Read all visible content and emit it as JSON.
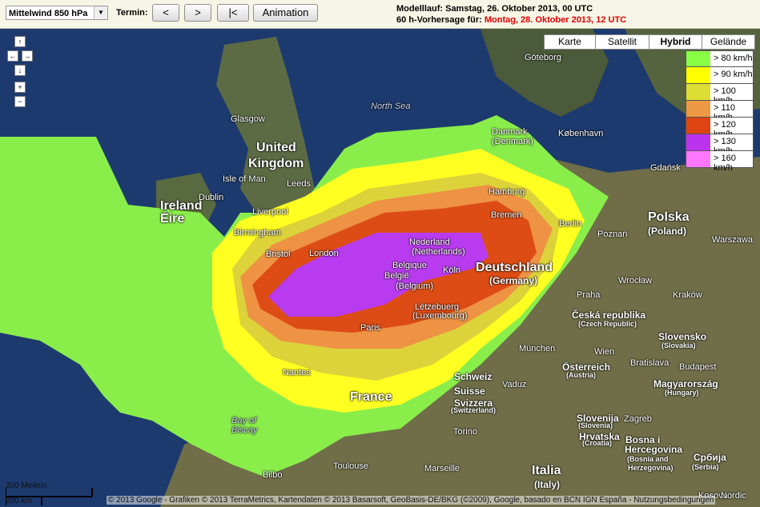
{
  "toolbar": {
    "level_select": "Mittelwind 850 hPa",
    "termin_label": "Termin:",
    "prev_button": "<",
    "next_button": ">",
    "first_button": "|<",
    "animation_button": "Animation"
  },
  "run_info": {
    "modelllauf": "Modelllauf: Samstag, 26. Oktober 2013, 00 UTC",
    "forecast_prefix": "60 h-Vorhersage für:",
    "forecast_time": "Montag, 28. Oktober 2013, 12 UTC"
  },
  "map_types": [
    "Karte",
    "Satellit",
    "Hybrid",
    "Gelände"
  ],
  "active_map_type": "Hybrid",
  "legend": [
    {
      "label": "> 80 km/h",
      "color": "#88ff44"
    },
    {
      "label": "> 90 km/h",
      "color": "#ffff00"
    },
    {
      "label": "> 100 km/h",
      "color": "#dddd33"
    },
    {
      "label": "> 110 km/h",
      "color": "#ee9944"
    },
    {
      "label": "> 120 km/h",
      "color": "#dd4411"
    },
    {
      "label": "> 130 km/h",
      "color": "#bb33ee"
    },
    {
      "label": "> 160 km/h",
      "color": "#ff77ff"
    }
  ],
  "nav_controls": {
    "up": "↑",
    "left": "←",
    "right": "→",
    "down": "↓",
    "zoom_in": "+",
    "zoom_out": "−"
  },
  "map_labels": [
    {
      "text": "Göteborg",
      "weight": "normal"
    },
    {
      "text": "North Sea",
      "weight": "italic"
    },
    {
      "text": "Glasgow",
      "weight": "normal"
    },
    {
      "text": "Danmark",
      "weight": "normal"
    },
    {
      "text": "(Denmark)",
      "weight": "normal"
    },
    {
      "text": "København",
      "weight": "normal"
    },
    {
      "text": "United",
      "weight": "big"
    },
    {
      "text": "Kingdom",
      "weight": "big"
    },
    {
      "text": "Isle of Man",
      "weight": "normal"
    },
    {
      "text": "Leeds",
      "weight": "normal"
    },
    {
      "text": "Ireland",
      "weight": "big"
    },
    {
      "text": "Éire",
      "weight": "big"
    },
    {
      "text": "Dublin",
      "weight": "normal"
    },
    {
      "text": "Liverpool",
      "weight": "normal"
    },
    {
      "text": "Gdańsk",
      "weight": "normal"
    },
    {
      "text": "Hamburg",
      "weight": "normal"
    },
    {
      "text": "Bremen",
      "weight": "normal"
    },
    {
      "text": "Birmingham",
      "weight": "normal"
    },
    {
      "text": "Berlin",
      "weight": "normal"
    },
    {
      "text": "Poznań",
      "weight": "normal"
    },
    {
      "text": "Polska",
      "weight": "big"
    },
    {
      "text": "(Poland)",
      "weight": "bold"
    },
    {
      "text": "Nederland",
      "weight": "normal"
    },
    {
      "text": "(Netherlands)",
      "weight": "normal"
    },
    {
      "text": "Bristol",
      "weight": "normal"
    },
    {
      "text": "London",
      "weight": "normal"
    },
    {
      "text": "Warszawa",
      "weight": "normal"
    },
    {
      "text": "Belgique",
      "weight": "normal"
    },
    {
      "text": "België",
      "weight": "normal"
    },
    {
      "text": "(Belgium)",
      "weight": "normal"
    },
    {
      "text": "Köln",
      "weight": "normal"
    },
    {
      "text": "Deutschland",
      "weight": "big"
    },
    {
      "text": "(Germany)",
      "weight": "bold"
    },
    {
      "text": "Wrocław",
      "weight": "normal"
    },
    {
      "text": "Praha",
      "weight": "normal"
    },
    {
      "text": "Kraków",
      "weight": "normal"
    },
    {
      "text": "Lëtzebuerg",
      "weight": "normal"
    },
    {
      "text": "(Luxembourg)",
      "weight": "normal"
    },
    {
      "text": "Česká republika",
      "weight": "bold"
    },
    {
      "text": "(Czech Republic)",
      "weight": "small"
    },
    {
      "text": "Paris",
      "weight": "normal"
    },
    {
      "text": "Slovensko",
      "weight": "bold"
    },
    {
      "text": "(Slovakia)",
      "weight": "small"
    },
    {
      "text": "München",
      "weight": "normal"
    },
    {
      "text": "Wien",
      "weight": "normal"
    },
    {
      "text": "Bratislava",
      "weight": "normal"
    },
    {
      "text": "Österreich",
      "weight": "bold"
    },
    {
      "text": "(Austria)",
      "weight": "small"
    },
    {
      "text": "Nantes",
      "weight": "normal"
    },
    {
      "text": "Schweiz",
      "weight": "bold"
    },
    {
      "text": "Suisse",
      "weight": "bold"
    },
    {
      "text": "Svizzera",
      "weight": "bold"
    },
    {
      "text": "(Switzerland)",
      "weight": "small"
    },
    {
      "text": "Vaduz",
      "weight": "normal"
    },
    {
      "text": "Budapest",
      "weight": "normal"
    },
    {
      "text": "Magyarország",
      "weight": "bold"
    },
    {
      "text": "(Hungary)",
      "weight": "small"
    },
    {
      "text": "France",
      "weight": "big"
    },
    {
      "text": "Slovenija",
      "weight": "bold"
    },
    {
      "text": "(Slovenia)",
      "weight": "small"
    },
    {
      "text": "Zagreb",
      "weight": "normal"
    },
    {
      "text": "Hrvatska",
      "weight": "bold"
    },
    {
      "text": "(Croatia)",
      "weight": "small"
    },
    {
      "text": "Bay of",
      "weight": "italic"
    },
    {
      "text": "Biscay",
      "weight": "italic"
    },
    {
      "text": "Torino",
      "weight": "normal"
    },
    {
      "text": "Bosna i",
      "weight": "bold"
    },
    {
      "text": "Hercegovina",
      "weight": "bold"
    },
    {
      "text": "(Bosnia and",
      "weight": "small"
    },
    {
      "text": "Herzegovina)",
      "weight": "small"
    },
    {
      "text": "Србија",
      "weight": "bold"
    },
    {
      "text": "(Serbia)",
      "weight": "small"
    },
    {
      "text": "Bilbo",
      "weight": "normal"
    },
    {
      "text": "Toulouse",
      "weight": "normal"
    },
    {
      "text": "Marseille",
      "weight": "normal"
    },
    {
      "text": "Italia",
      "weight": "big"
    },
    {
      "text": "(Italy)",
      "weight": "bold"
    },
    {
      "text": "Kosova",
      "weight": "normal"
    },
    {
      "text": "Nordic",
      "weight": "normal"
    }
  ],
  "scale": {
    "miles": "200 Meile/n",
    "km": "200 km"
  },
  "copyright": "© 2013 Google - Grafiken © 2013 TerraMetrics, Kartendaten © 2013 Basarsoft, GeoBasis-DE/BKG (©2009), Google, basado en BCN IGN España - Nutzungsbedingungen"
}
